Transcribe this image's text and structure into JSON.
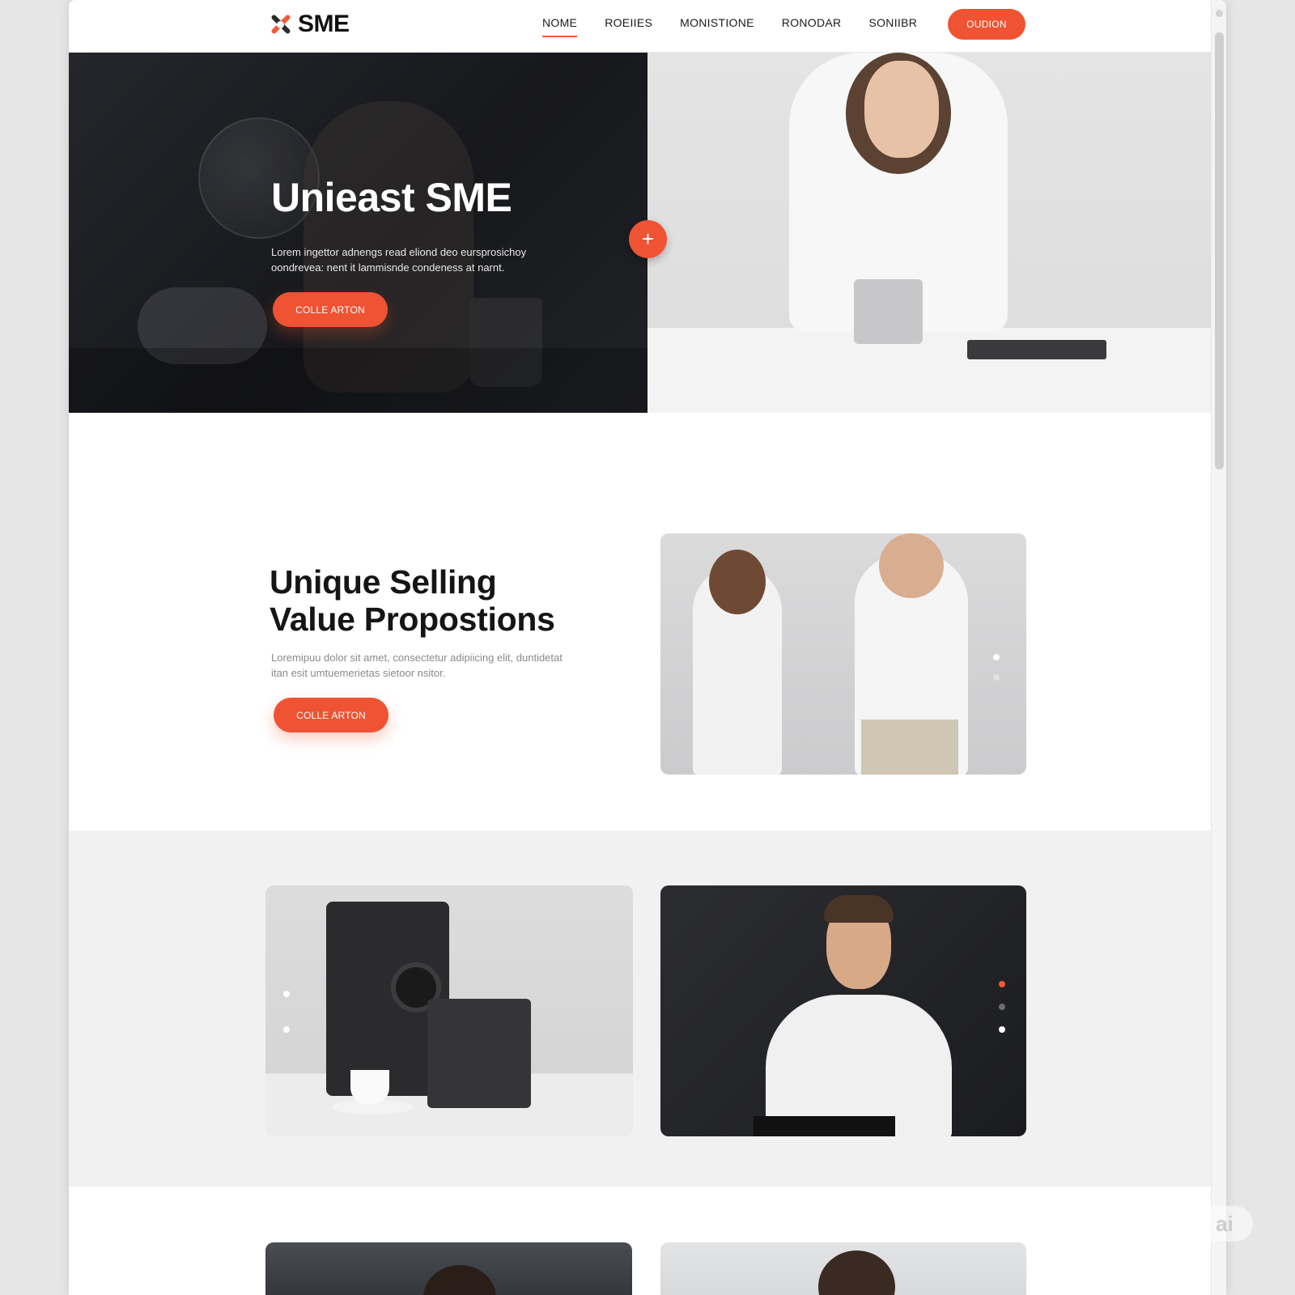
{
  "header": {
    "logo_text": "SME",
    "nav": [
      "NOME",
      "ROEIIES",
      "MONISTIONE",
      "RONODAR",
      "SONIIBR"
    ],
    "active_nav": "NOME",
    "cta_label": "OUDION"
  },
  "hero": {
    "title": "Unieast SME",
    "text": "Lorem ingettor adnengs read eliond deo eursprosichoy oondrevea: nent it lammisnde condeness at narnt.",
    "button_label": "COLLE ARTON",
    "plus_symbol": "+"
  },
  "usp": {
    "title_line1": "Unique Selling",
    "title_line2": "Value Propostions",
    "text": "Loremipuu dolor sit amet, consectetur adipiicing elit, duntidetat itan esit umtuemerietas sietoor nsitor.",
    "button_label": "COLLE ARTON"
  },
  "watermark": "ai",
  "colors": {
    "accent": "#ef5333",
    "dark": "#1b1c1f",
    "text": "#151515",
    "muted": "#8a8a8a"
  },
  "icons": [
    "sme-logo-icon",
    "plus-icon"
  ]
}
